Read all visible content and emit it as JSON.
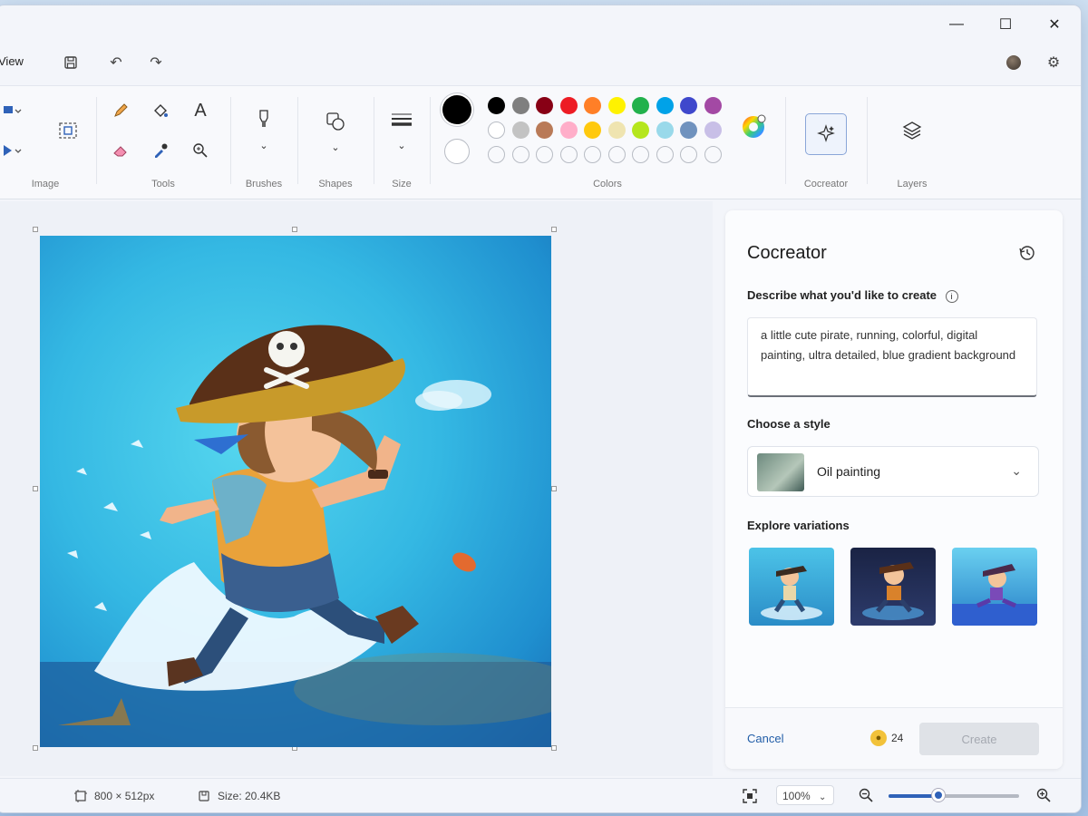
{
  "window": {
    "controls": {
      "minimize": "—",
      "maximize": "☐",
      "close": "✕"
    }
  },
  "menu": {
    "view_label": "View",
    "save_icon": "💾",
    "undo_icon": "↶",
    "redo_icon": "↷",
    "settings_icon": "⚙"
  },
  "ribbon": {
    "groups": {
      "image": "Image",
      "tools": "Tools",
      "brushes": "Brushes",
      "shapes": "Shapes",
      "size": "Size",
      "colors": "Colors",
      "cocreator": "Cocreator",
      "layers": "Layers"
    },
    "tools": {
      "text_glyph": "A"
    },
    "colors": {
      "primary": "#000000",
      "secondary": "#ffffff",
      "row1": [
        "#000000",
        "#7f7f7f",
        "#880015",
        "#ed1c24",
        "#ff7f27",
        "#fff200",
        "#22b14c",
        "#00a2e8",
        "#3f48cc",
        "#a349a4"
      ],
      "row2": [
        "#ffffff",
        "#c3c3c3",
        "#b97a57",
        "#ffaec9",
        "#ffc90e",
        "#efe4b0",
        "#b5e61d",
        "#99d9ea",
        "#7092be",
        "#c8bfe7"
      ]
    }
  },
  "cocreator_panel": {
    "title": "Cocreator",
    "describe_label": "Describe what you'd like to create",
    "prompt_text": "a little cute pirate, running, colorful, digital painting, ultra detailed, blue gradient background",
    "style_label": "Choose a style",
    "style_value": "Oil painting",
    "variations_label": "Explore variations",
    "cancel_label": "Cancel",
    "credits": "24",
    "create_label": "Create"
  },
  "statusbar": {
    "dimensions": "800 × 512px",
    "size": "Size: 20.4KB",
    "zoom": "100%",
    "zoom_level": 0.38
  }
}
